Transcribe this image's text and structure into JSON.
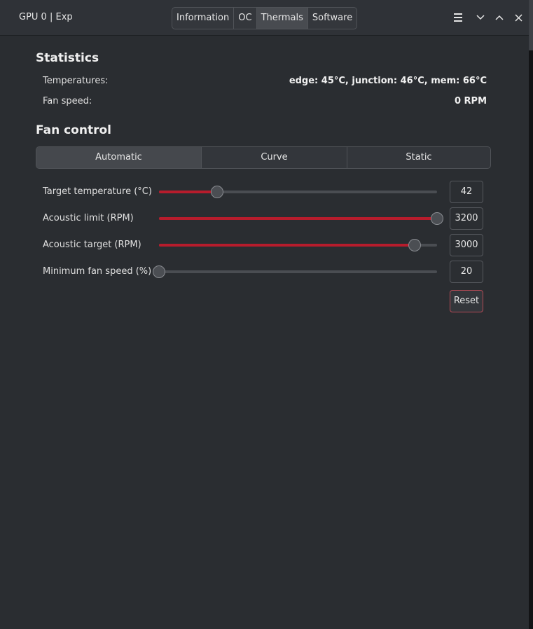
{
  "window": {
    "title": "GPU 0 | Exp",
    "tabs": [
      {
        "label": "Information",
        "active": false
      },
      {
        "label": "OC",
        "active": false
      },
      {
        "label": "Thermals",
        "active": true
      },
      {
        "label": "Software",
        "active": false
      }
    ],
    "controls": [
      "menu-icon",
      "minimize-icon",
      "maximize-icon",
      "close-icon"
    ]
  },
  "statistics": {
    "heading": "Statistics",
    "temperatures_label": "Temperatures:",
    "temperatures_value": "edge: 45°C, junction: 46°C, mem: 66°C",
    "fan_speed_label": "Fan speed:",
    "fan_speed_value": "0 RPM"
  },
  "fan_control": {
    "heading": "Fan control",
    "modes": [
      {
        "label": "Automatic",
        "active": true
      },
      {
        "label": "Curve",
        "active": false
      },
      {
        "label": "Static",
        "active": false
      }
    ],
    "sliders": [
      {
        "label": "Target temperature (°C)",
        "value": "42",
        "level": 0.21
      },
      {
        "label": "Acoustic limit (RPM)",
        "value": "3200",
        "level": 1.0
      },
      {
        "label": "Acoustic target (RPM)",
        "value": "3000",
        "level": 0.92
      },
      {
        "label": "Minimum fan speed (%)",
        "value": "20",
        "level": 0.0
      }
    ],
    "reset_label": "Reset"
  },
  "colors": {
    "accent": "#b71c2c",
    "background": "#2a2d31",
    "headerbar": "#2f3237"
  }
}
